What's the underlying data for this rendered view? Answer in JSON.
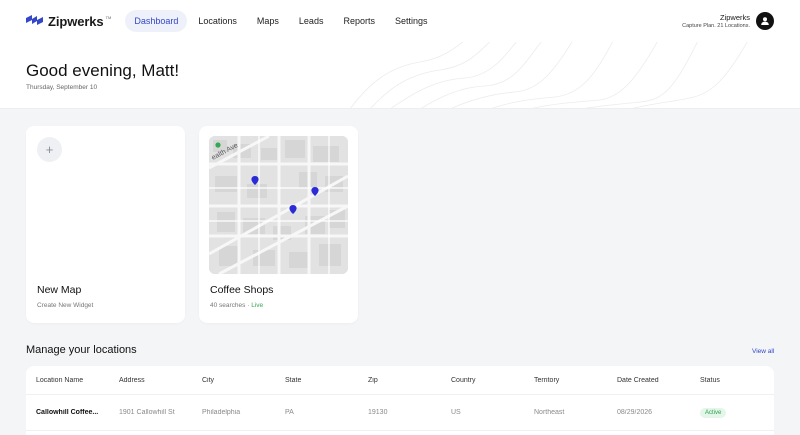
{
  "brand": {
    "name": "Zipwerks",
    "tm": "TM",
    "logo_icon": "zipwerks-logo-icon",
    "accent": "#3347c8"
  },
  "nav": {
    "items": [
      {
        "label": "Dashboard",
        "active": true
      },
      {
        "label": "Locations",
        "active": false
      },
      {
        "label": "Maps",
        "active": false
      },
      {
        "label": "Leads",
        "active": false
      },
      {
        "label": "Reports",
        "active": false
      },
      {
        "label": "Settings",
        "active": false
      }
    ]
  },
  "account": {
    "name": "Zipwerks",
    "plan": "Capture Plan. 21 Locations.",
    "avatar_icon": "user-avatar-icon"
  },
  "hero": {
    "greeting": "Good evening, Matt!",
    "date": "Thursday, September 10"
  },
  "widgets": {
    "new_map": {
      "title": "New Map",
      "subtitle": "Create New Widget",
      "icon": "plus-icon"
    },
    "coffee": {
      "title": "Coffee Shops",
      "subtitle": "40 searches · ",
      "status": "Live",
      "map_street": "ealth Ave"
    }
  },
  "locations": {
    "title": "Manage your locations",
    "view_all": "View all",
    "columns": [
      "Location Name",
      "Address",
      "City",
      "State",
      "Zip",
      "Country",
      "Territory",
      "Date Created",
      "Status"
    ],
    "rows": [
      [
        "Callowhill Coffee...",
        "1901 Callowhill St",
        "Philadelphia",
        "PA",
        "19130",
        "US",
        "Northeast",
        "08/29/2026",
        "Active"
      ]
    ]
  }
}
